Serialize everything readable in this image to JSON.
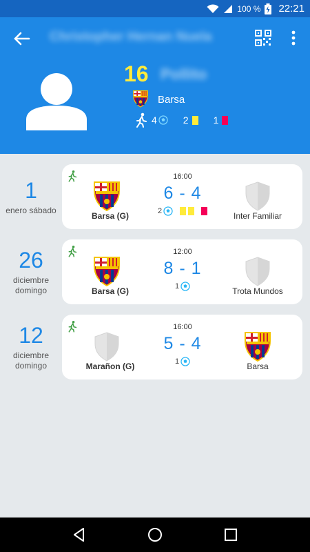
{
  "status_bar": {
    "battery": "100 %",
    "time": "22:21"
  },
  "header": {
    "title": "Christopher Hernan Nuela",
    "jersey_number": "16",
    "nickname": "Pollito",
    "team": "Barsa",
    "stats": {
      "goals": "4",
      "yellow_cards": "2",
      "red_cards": "1"
    }
  },
  "matches": [
    {
      "day": "1",
      "date_text": "enero sábado",
      "time": "16:00",
      "home": "Barsa (G)",
      "away": "Inter Familiar",
      "score": "6 - 4",
      "home_crest": "barca",
      "away_crest": "generic",
      "goals": "2",
      "yellow": true,
      "red": true
    },
    {
      "day": "26",
      "date_text": "diciembre domingo",
      "time": "12:00",
      "home": "Barsa (G)",
      "away": "Trota Mundos",
      "score": "8 - 1",
      "home_crest": "barca",
      "away_crest": "generic",
      "goals": "1",
      "yellow": false,
      "red": false
    },
    {
      "day": "12",
      "date_text": "diciembre domingo",
      "time": "16:00",
      "home": "Marañon (G)",
      "away": "Barsa",
      "score": "5 - 4",
      "home_crest": "generic",
      "away_crest": "barca",
      "goals": "1",
      "yellow": false,
      "red": false
    }
  ],
  "colors": {
    "primary": "#1e88e5",
    "status_bar": "#1565c0",
    "jersey": "#ffeb3b",
    "yellow_card": "#ffeb3b",
    "red_card": "#f50057",
    "runner": "#43a047"
  },
  "icons": {
    "back": "arrow-back-icon",
    "qr": "qr-code-icon",
    "more": "more-vert-icon",
    "player": "runner-icon",
    "goal": "soccer-ball-icon"
  }
}
